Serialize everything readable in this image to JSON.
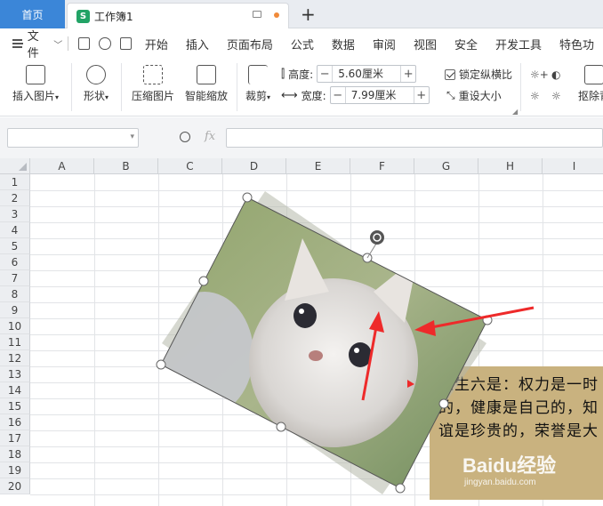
{
  "titlebar": {
    "home_tab": "首页",
    "doc_tab": "工作簿1",
    "doc_icon_letter": "S",
    "add_tab": "+"
  },
  "menubar": {
    "file_label": "文件",
    "items": [
      "开始",
      "插入",
      "页面布局",
      "公式",
      "数据",
      "审阅",
      "视图",
      "安全",
      "开发工具",
      "特色功"
    ]
  },
  "ribbon": {
    "insert_picture": "插入图片",
    "shape": "形状",
    "compress_picture": "压缩图片",
    "smart_scale": "智能缩放",
    "crop": "裁剪",
    "height_label": "高度:",
    "height_value": "5.60厘米",
    "width_label": "宽度:",
    "width_value": "7.99厘米",
    "lock_ratio": "锁定纵横比",
    "reset_size": "重设大小",
    "remove_bg": "抠除背"
  },
  "formulabar": {
    "fx": "fx",
    "name_box": "",
    "formula": ""
  },
  "grid": {
    "columns": [
      "A",
      "B",
      "C",
      "D",
      "E",
      "F",
      "G",
      "H",
      "I"
    ],
    "rows": [
      "1",
      "2",
      "3",
      "4",
      "5",
      "6",
      "7",
      "8",
      "9",
      "10",
      "11",
      "12",
      "13",
      "14",
      "15",
      "16",
      "17",
      "18",
      "19",
      "20"
    ]
  },
  "textbox": {
    "line1": "人生六是：权力是一时",
    "line2": "的，健康是自己的，知",
    "line3": "谊是珍贵的，荣誉是大"
  },
  "watermark": {
    "brand": "Baidu经验",
    "url": "jingyan.baidu.com"
  },
  "colors": {
    "home_tab": "#3b86d8",
    "doc_icon": "#22a366",
    "arrow": "#ee2a2a",
    "handle": "#ffffff",
    "rotate_handle": "#555555"
  }
}
